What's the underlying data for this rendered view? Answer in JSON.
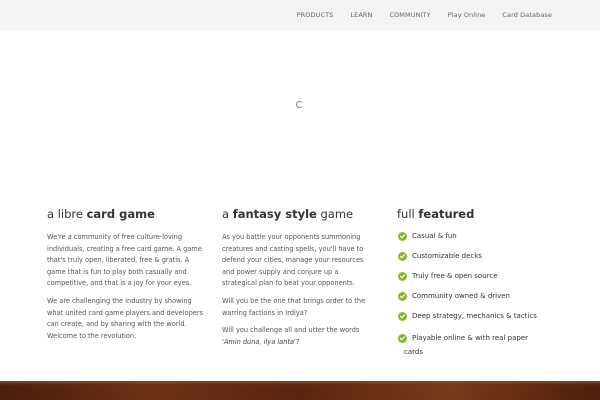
{
  "nav": {
    "items": [
      {
        "label": "PRODUCTS"
      },
      {
        "label": "LEARN"
      },
      {
        "label": "COMMUNITY"
      },
      {
        "label": "Play Online"
      },
      {
        "label": "Card Database"
      }
    ]
  },
  "spinner": {
    "icon": "loading-spinner-icon"
  },
  "columns": {
    "libre": {
      "heading_lead": "a libre ",
      "heading_strong": "card game",
      "paragraphs": [
        "We're a community of free culture-loving individuals, creating a free card game. A game that's truly open, liberated, free & gratis. A game that is fun to play both casually and competitive, and that is a joy for your eyes.",
        "We are challenging the industry by showing what united card game players and developers can create, and by sharing with the world. Welcome to the revolution."
      ]
    },
    "fantasy": {
      "heading_lead": "a ",
      "heading_strong": "fantasy style",
      "heading_tail": " game",
      "paragraphs": [
        "As you battle your opponents summoning creatures and casting spells, you'll have to defend your cities, manage your resources and power supply and conjure up a strategical plan to beat your opponents.",
        "Will you be the one that brings order to the warring factions in Irdiya?"
      ],
      "challenge_text": "Will you challenge all and utter the words ",
      "quote": "'Amin duna, ilya lanta'",
      "quote_end": "?"
    },
    "featured": {
      "heading_lead": "full ",
      "heading_strong": "featured",
      "features": [
        "Casual & fun",
        "Customizable decks",
        "Truly free & open source",
        "Community owned & driven",
        "Deep strategy, mechanics & tactics"
      ],
      "last_feature_line1": "Playable online & with real paper",
      "last_feature_line2": "cards",
      "check_icon": "check-circle-icon",
      "accent_color": "#8cb52a"
    }
  }
}
